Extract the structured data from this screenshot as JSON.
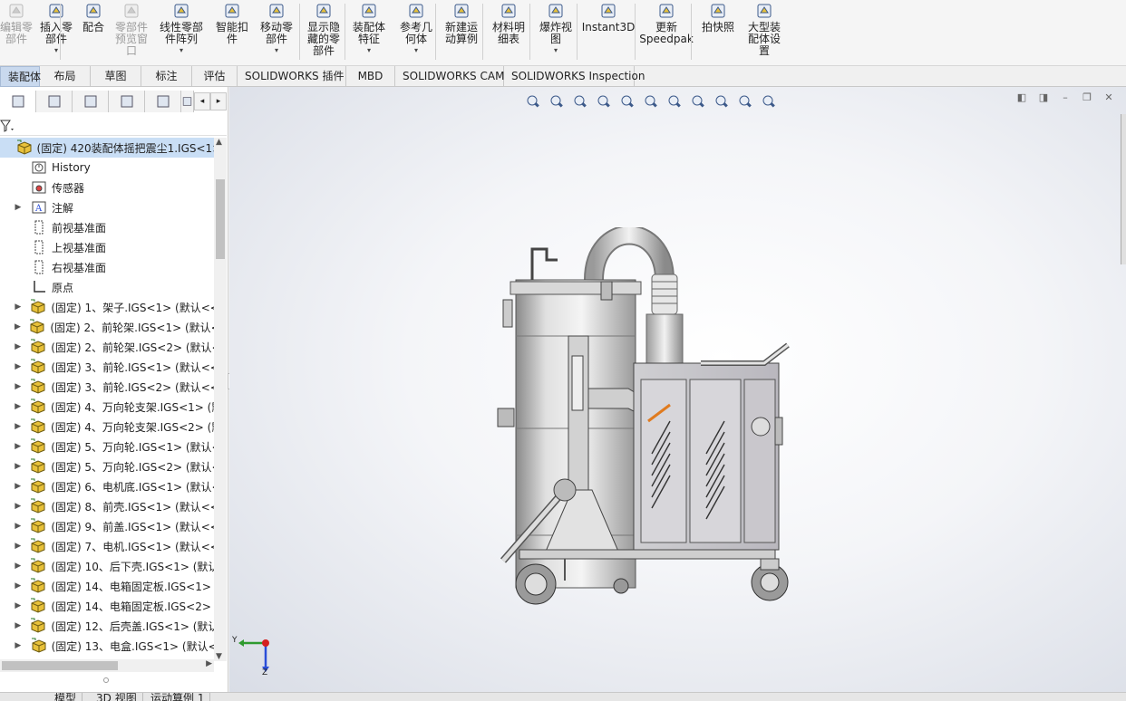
{
  "ribbon": {
    "buttons": [
      {
        "label": "编辑零\n部件",
        "icon": "edit-component-icon",
        "disabled": true
      },
      {
        "label": "插入零\n部件",
        "icon": "insert-component-icon",
        "arrow": "▾"
      },
      {
        "label": "配合",
        "icon": "mate-paperclip-icon"
      },
      {
        "label": "零部件\n预览窗\n口",
        "icon": "component-preview-icon",
        "disabled": true
      },
      {
        "label": "线性零部\n件阵列",
        "icon": "linear-pattern-icon",
        "arrow": "▾"
      },
      {
        "label": "智能扣\n件",
        "icon": "smart-fasteners-icon"
      },
      {
        "label": "移动零\n部件",
        "icon": "move-component-icon",
        "arrow": "▾"
      },
      {
        "label": "显示隐\n藏的零\n部件",
        "icon": "show-hidden-icon"
      },
      {
        "label": "装配体\n特征",
        "icon": "assembly-features-icon",
        "arrow": "▾"
      },
      {
        "label": "参考几\n何体",
        "icon": "reference-geometry-icon",
        "arrow": "▾"
      },
      {
        "label": "新建运\n动算例",
        "icon": "new-motion-study-icon"
      },
      {
        "label": "材料明\n细表",
        "icon": "bom-icon"
      },
      {
        "label": "爆炸视\n图",
        "icon": "exploded-view-icon",
        "arrow": "▾"
      },
      {
        "label": "Instant3D",
        "icon": "instant3d-icon"
      },
      {
        "label": "更新\nSpeedpak",
        "icon": "speedpak-icon"
      },
      {
        "label": "拍快照",
        "icon": "snapshot-icon"
      },
      {
        "label": "大型装\n配体设\n置",
        "icon": "large-assembly-icon"
      }
    ]
  },
  "tabs": [
    {
      "label": "装配体",
      "active": true
    },
    {
      "label": "布局"
    },
    {
      "label": "草图"
    },
    {
      "label": "标注"
    },
    {
      "label": "评估"
    },
    {
      "label": "SOLIDWORKS 插件"
    },
    {
      "label": "MBD"
    },
    {
      "label": "SOLIDWORKS CAM"
    },
    {
      "label": "SOLIDWORKS Inspection"
    }
  ],
  "pane_tabs": [
    {
      "icon": "feature-manager-icon"
    },
    {
      "icon": "property-manager-icon"
    },
    {
      "icon": "configuration-manager-icon"
    },
    {
      "icon": "dimxpert-icon"
    },
    {
      "icon": "display-manager-icon"
    },
    {
      "icon": "cam-manager-icon"
    }
  ],
  "tree": {
    "root": "(固定) 420装配体摇把震尘1.IGS<1>",
    "items": [
      {
        "label": "History",
        "icon": "history-icon",
        "exp": ""
      },
      {
        "label": "传感器",
        "icon": "sensor-icon",
        "exp": ""
      },
      {
        "label": "注解",
        "icon": "annotation-icon",
        "exp": "▶"
      },
      {
        "label": "前视基准面",
        "icon": "plane-icon",
        "exp": ""
      },
      {
        "label": "上视基准面",
        "icon": "plane-icon",
        "exp": ""
      },
      {
        "label": "右视基准面",
        "icon": "plane-icon",
        "exp": ""
      },
      {
        "label": "原点",
        "icon": "origin-icon",
        "exp": ""
      },
      {
        "label": "(固定) 1、架子.IGS<1> (默认<<",
        "icon": "part-icon",
        "exp": "▶"
      },
      {
        "label": "(固定) 2、前轮架.IGS<1> (默认<<",
        "icon": "part-icon",
        "exp": "▶"
      },
      {
        "label": "(固定) 2、前轮架.IGS<2> (默认<",
        "icon": "part-icon",
        "exp": "▶"
      },
      {
        "label": "(固定) 3、前轮.IGS<1> (默认<<",
        "icon": "part-icon",
        "exp": "▶"
      },
      {
        "label": "(固定) 3、前轮.IGS<2> (默认<<",
        "icon": "part-icon",
        "exp": "▶"
      },
      {
        "label": "(固定) 4、万向轮支架.IGS<1> (默",
        "icon": "part-icon",
        "exp": "▶"
      },
      {
        "label": "(固定) 4、万向轮支架.IGS<2> (默",
        "icon": "part-icon",
        "exp": "▶"
      },
      {
        "label": "(固定) 5、万向轮.IGS<1> (默认<",
        "icon": "part-icon",
        "exp": "▶"
      },
      {
        "label": "(固定) 5、万向轮.IGS<2> (默认<",
        "icon": "part-icon",
        "exp": "▶"
      },
      {
        "label": "(固定) 6、电机底.IGS<1> (默认<",
        "icon": "part-icon",
        "exp": "▶"
      },
      {
        "label": "(固定) 8、前壳.IGS<1> (默认<<",
        "icon": "part-icon",
        "exp": "▶"
      },
      {
        "label": "(固定) 9、前盖.IGS<1> (默认<<",
        "icon": "part-icon",
        "exp": "▶"
      },
      {
        "label": "(固定) 7、电机.IGS<1> (默认<<",
        "icon": "part-icon",
        "exp": "▶"
      },
      {
        "label": "(固定) 10、后下壳.IGS<1> (默认",
        "icon": "part-icon",
        "exp": "▶"
      },
      {
        "label": "(固定) 14、电箱固定板.IGS<1> (",
        "icon": "part-icon",
        "exp": "▶"
      },
      {
        "label": "(固定) 14、电箱固定板.IGS<2> (",
        "icon": "part-icon",
        "exp": "▶"
      },
      {
        "label": "(固定) 12、后壳盖.IGS<1> (默认",
        "icon": "part-icon",
        "exp": "▶"
      },
      {
        "label": "(固定) 13、电盒.IGS<1> (默认<",
        "icon": "part-icon",
        "exp": "▶"
      }
    ]
  },
  "bottom_tabs": [
    {
      "label": "模型"
    },
    {
      "label": "3D 视图"
    },
    {
      "label": "运动算例 1"
    }
  ],
  "viewport": {
    "triad": {
      "y_label": "Y",
      "z_label": "Z"
    },
    "heads_up_icons": [
      "zoom-to-fit-icon",
      "zoom-area-icon",
      "previous-view-icon",
      "section-view-icon",
      "dynamic-annotation-icon",
      "view-orientation-icon",
      "display-style-icon",
      "hide-show-icon",
      "edit-appearance-icon",
      "apply-scene-icon",
      "view-settings-icon"
    ],
    "window_controls": [
      "tile-left-icon",
      "tile-right-icon",
      "minimize-icon",
      "restore-icon",
      "close-icon"
    ]
  },
  "colors": {
    "active_tab": "#c9d9ee",
    "selection": "#c9def5",
    "part_icon": "#e8c13a",
    "viewport_edge": "#d9dde6"
  }
}
